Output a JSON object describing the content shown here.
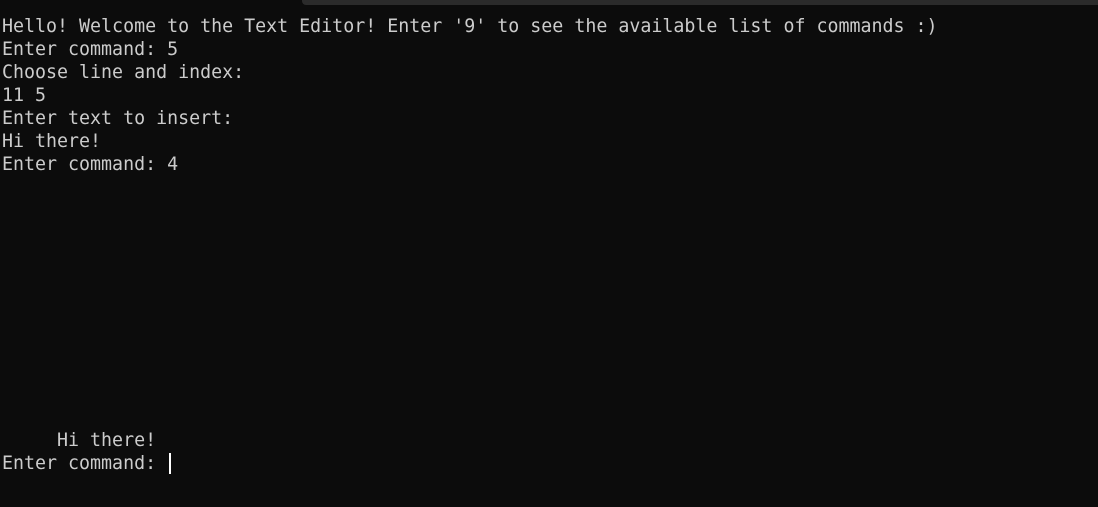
{
  "terminal": {
    "lines": [
      "Hello! Welcome to the Text Editor! Enter '9' to see the available list of commands :)",
      "Enter command: 5",
      "Choose line and index:",
      "11 5",
      "Enter text to insert:",
      "Hi there!",
      "Enter command: 4"
    ],
    "output_line": "     Hi there!",
    "prompt": "Enter command: "
  }
}
